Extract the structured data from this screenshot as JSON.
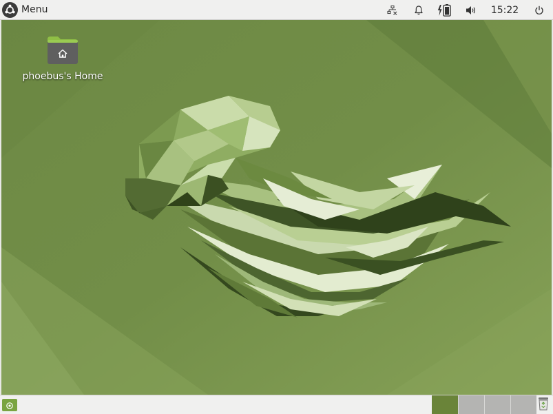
{
  "top_panel": {
    "menu_label": "Menu",
    "menu_icon": "ubuntu-logo-icon",
    "tray": [
      {
        "name": "network-disconnected-icon"
      },
      {
        "name": "notification-bell-icon"
      },
      {
        "name": "battery-charging-icon"
      },
      {
        "name": "volume-icon"
      }
    ],
    "clock": "15:22",
    "power_icon": "power-icon"
  },
  "desktop": {
    "icons": [
      {
        "label": "phoebus's Home",
        "icon": "home-folder-icon"
      }
    ],
    "colors": {
      "wallpaper_base": "#6f8b47",
      "wallpaper_light": "#86a157",
      "wallpaper_dark": "#5c7738"
    }
  },
  "bottom_panel": {
    "show_desktop_icon": "show-desktop-icon",
    "workspaces": [
      {
        "id": 1,
        "active": true
      },
      {
        "id": 2,
        "active": false
      },
      {
        "id": 3,
        "active": false
      },
      {
        "id": 4,
        "active": false
      }
    ],
    "trash_icon": "trash-icon",
    "accent_color": "#6a8439"
  }
}
